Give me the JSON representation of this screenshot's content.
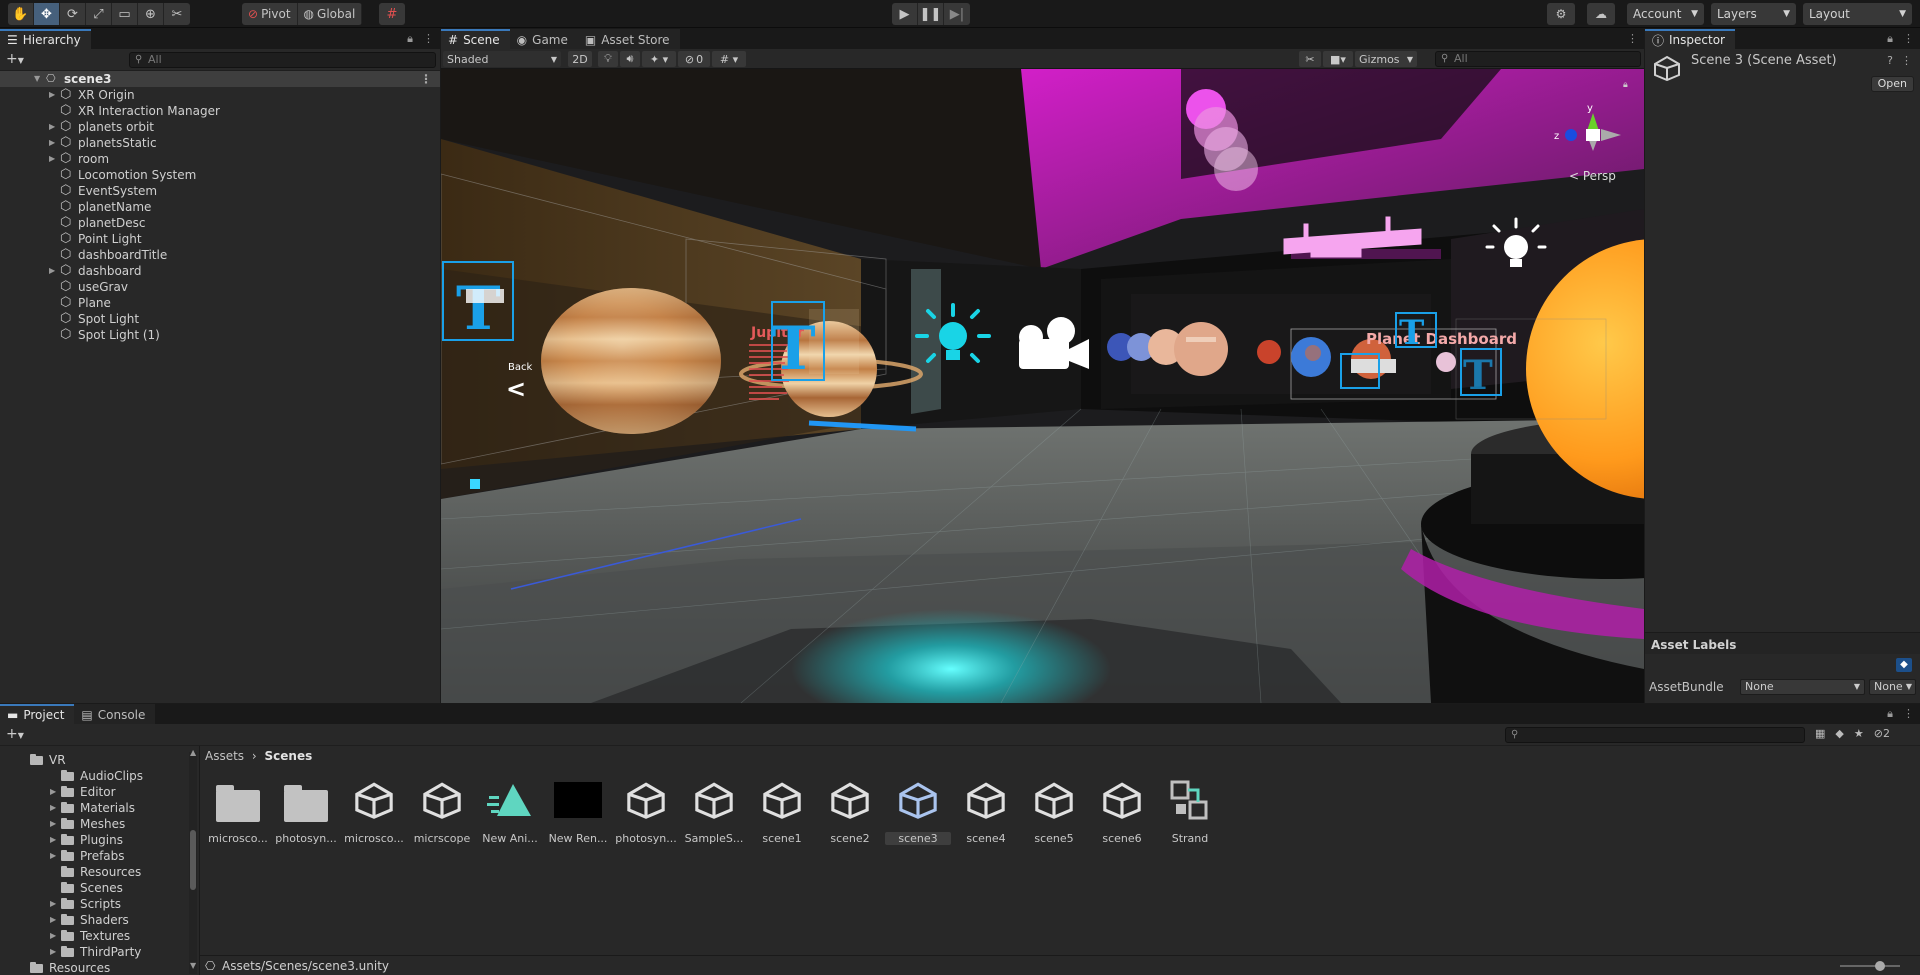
{
  "toolbar": {
    "pivot_label": "Pivot",
    "global_label": "Global",
    "account_label": "Account",
    "layers_label": "Layers",
    "layout_label": "Layout"
  },
  "hierarchy": {
    "tab_label": "Hierarchy",
    "search_placeholder": "All",
    "scene_name": "scene3",
    "items": [
      {
        "label": "XR Origin",
        "expandable": true
      },
      {
        "label": "XR Interaction Manager",
        "expandable": false
      },
      {
        "label": "planets orbit",
        "expandable": true
      },
      {
        "label": "planetsStatic",
        "expandable": true
      },
      {
        "label": "room",
        "expandable": true
      },
      {
        "label": "Locomotion System",
        "expandable": false
      },
      {
        "label": "EventSystem",
        "expandable": false
      },
      {
        "label": "planetName",
        "expandable": false
      },
      {
        "label": "planetDesc",
        "expandable": false
      },
      {
        "label": "Point Light",
        "expandable": false
      },
      {
        "label": "dashboardTitle",
        "expandable": false
      },
      {
        "label": "dashboard",
        "expandable": true
      },
      {
        "label": "useGrav",
        "expandable": false
      },
      {
        "label": "Plane",
        "expandable": false
      },
      {
        "label": "Spot Light",
        "expandable": false
      },
      {
        "label": "Spot Light (1)",
        "expandable": false
      }
    ]
  },
  "scene_view": {
    "tabs": [
      {
        "label": "Scene",
        "icon": "grid-icon"
      },
      {
        "label": "Game",
        "icon": "gamepad-icon"
      },
      {
        "label": "Asset Store",
        "icon": "bag-icon"
      }
    ],
    "shading_mode": "Shaded",
    "two_d_label": "2D",
    "hidden_count": "0",
    "gizmos_label": "Gizmos",
    "search_placeholder": "All",
    "persp_label": "Persp",
    "back_label": "Back",
    "back_arrow": "<",
    "jupiter_label": "Jupiter",
    "dashboard_label": "Planet Dashboard",
    "axis_y": "y",
    "axis_z": "z"
  },
  "inspector": {
    "tab_label": "Inspector",
    "title": "Scene 3 (Scene Asset)",
    "open_button": "Open",
    "asset_labels_header": "Asset Labels",
    "assetbundle_label": "AssetBundle",
    "assetbundle_value": "None",
    "assetbundle_variant": "None"
  },
  "project": {
    "tabs": [
      {
        "label": "Project",
        "icon": "folder-icon"
      },
      {
        "label": "Console",
        "icon": "console-icon"
      }
    ],
    "hidden_count": "2",
    "tree": [
      {
        "label": "VR",
        "depth": 0,
        "expandable": true,
        "expanded": true
      },
      {
        "label": "AudioClips",
        "depth": 1,
        "expandable": false
      },
      {
        "label": "Editor",
        "depth": 1,
        "expandable": true
      },
      {
        "label": "Materials",
        "depth": 1,
        "expandable": true
      },
      {
        "label": "Meshes",
        "depth": 1,
        "expandable": true
      },
      {
        "label": "Plugins",
        "depth": 1,
        "expandable": true
      },
      {
        "label": "Prefabs",
        "depth": 1,
        "expandable": true
      },
      {
        "label": "Resources",
        "depth": 1,
        "expandable": false
      },
      {
        "label": "Scenes",
        "depth": 1,
        "expandable": false
      },
      {
        "label": "Scripts",
        "depth": 1,
        "expandable": true
      },
      {
        "label": "Shaders",
        "depth": 1,
        "expandable": true
      },
      {
        "label": "Textures",
        "depth": 1,
        "expandable": true
      },
      {
        "label": "ThirdParty",
        "depth": 1,
        "expandable": true
      },
      {
        "label": "Resources",
        "depth": 0,
        "expandable": false
      }
    ],
    "breadcrumb": [
      "Assets",
      "Scenes"
    ],
    "assets": [
      {
        "name": "microsco...",
        "kind": "folder"
      },
      {
        "name": "photosyn...",
        "kind": "folder"
      },
      {
        "name": "microsco...",
        "kind": "scene"
      },
      {
        "name": "micrscope",
        "kind": "scene"
      },
      {
        "name": "New Ani...",
        "kind": "anim"
      },
      {
        "name": "New Ren...",
        "kind": "render"
      },
      {
        "name": "photosyn...",
        "kind": "scene"
      },
      {
        "name": "SampleS...",
        "kind": "scene"
      },
      {
        "name": "scene1",
        "kind": "scene"
      },
      {
        "name": "scene2",
        "kind": "scene"
      },
      {
        "name": "scene3",
        "kind": "scene",
        "selected": true
      },
      {
        "name": "scene4",
        "kind": "scene"
      },
      {
        "name": "scene5",
        "kind": "scene"
      },
      {
        "name": "scene6",
        "kind": "scene"
      },
      {
        "name": "Strand",
        "kind": "graph"
      }
    ],
    "status_path": "Assets/Scenes/scene3.unity"
  },
  "colors": {
    "accent_blue": "#3a79bb",
    "panel_bg": "#282828",
    "toolbar_bg": "#191919",
    "selected_bg": "#46607c"
  }
}
